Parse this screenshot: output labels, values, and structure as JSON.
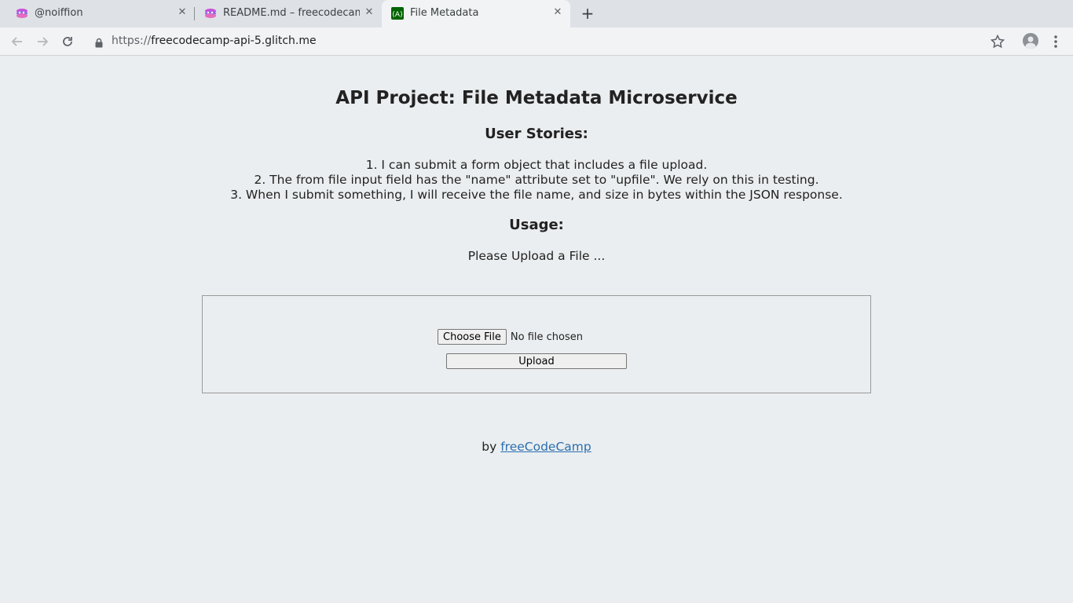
{
  "browser": {
    "tabs": [
      {
        "title": "@noiffion",
        "icon": "glitch-icon",
        "active": false
      },
      {
        "title": "README.md – freecodecamp",
        "icon": "glitch-icon",
        "active": false
      },
      {
        "title": "File Metadata",
        "icon": "freecodecamp-icon",
        "active": true
      }
    ],
    "url_scheme": "https://",
    "url_host": "freecodecamp-api-5.glitch.me",
    "colors": {
      "tabstrip": "#dee1e6",
      "toolbar": "#f1f3f4"
    }
  },
  "page": {
    "title": "API Project: File Metadata Microservice",
    "stories_heading": "User Stories:",
    "stories": [
      "1. I can submit a form object that includes a file upload.",
      "2. The from file input field has the \"name\" attribute set to \"upfile\". We rely on this in testing.",
      "3. When I submit something, I will receive the file name, and size in bytes within the JSON response."
    ],
    "usage_heading": "Usage:",
    "upload_prompt": "Please Upload a File ...",
    "form": {
      "choose_file_label": "Choose File",
      "file_status": "No file chosen",
      "upload_label": "Upload"
    },
    "footer": {
      "prefix": "by",
      "link_text": "freeCodeCamp"
    },
    "colors": {
      "background": "#ebeef0",
      "link": "#2a6eb0"
    }
  }
}
